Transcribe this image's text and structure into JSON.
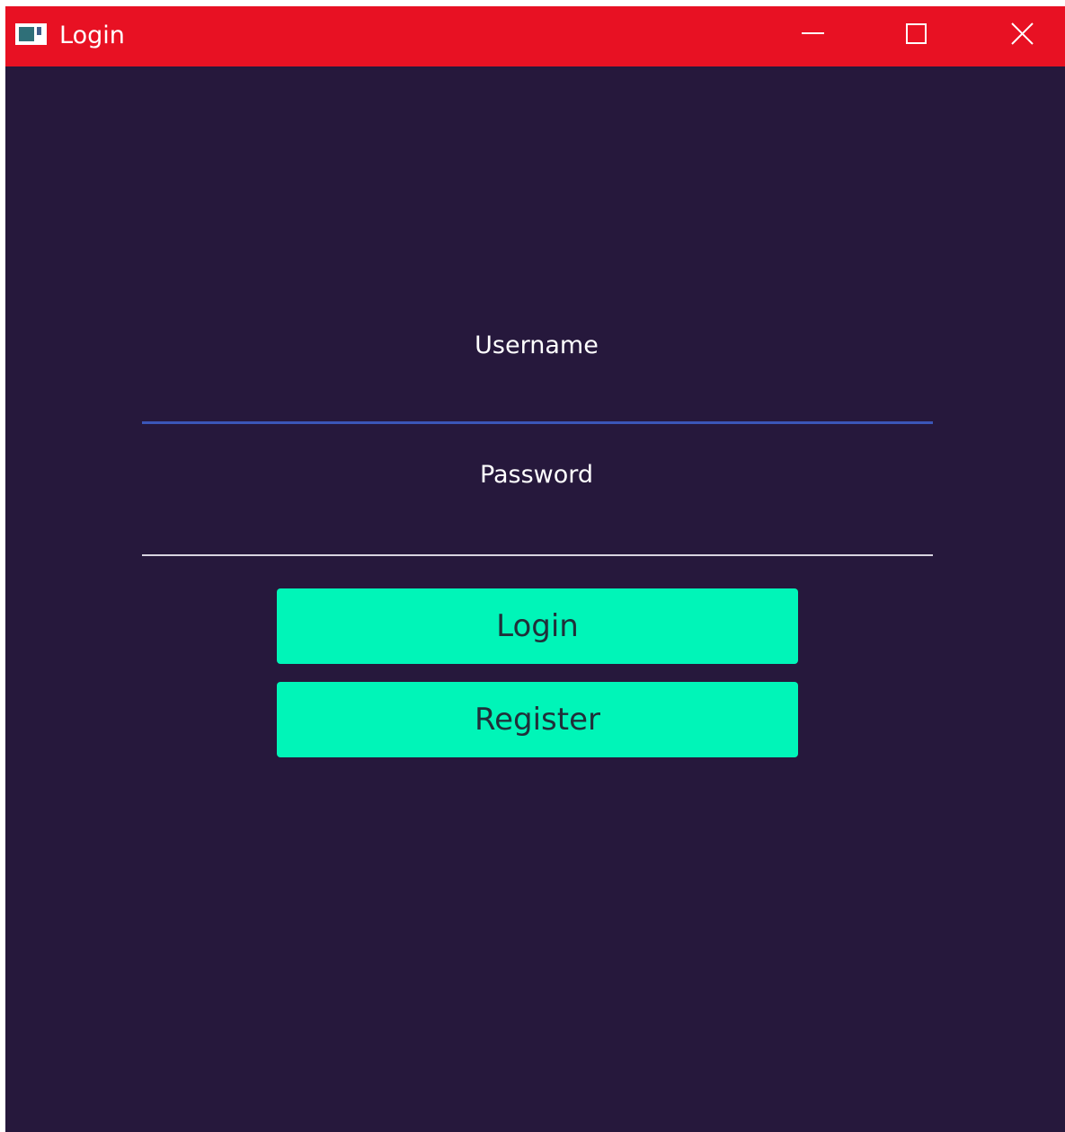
{
  "window": {
    "title": "Login",
    "titlebar_color": "#e81123",
    "background_color": "#26183c",
    "controls": {
      "minimize_icon": "minimize-icon",
      "maximize_icon": "maximize-icon",
      "close_icon": "close-icon"
    }
  },
  "form": {
    "username": {
      "label": "Username",
      "value": "",
      "underline_color": "#3b56b8"
    },
    "password": {
      "label": "Password",
      "value": "",
      "underline_color": "#d8d4e0"
    },
    "buttons": {
      "login_label": "Login",
      "register_label": "Register",
      "color": "#00f5b8"
    }
  }
}
